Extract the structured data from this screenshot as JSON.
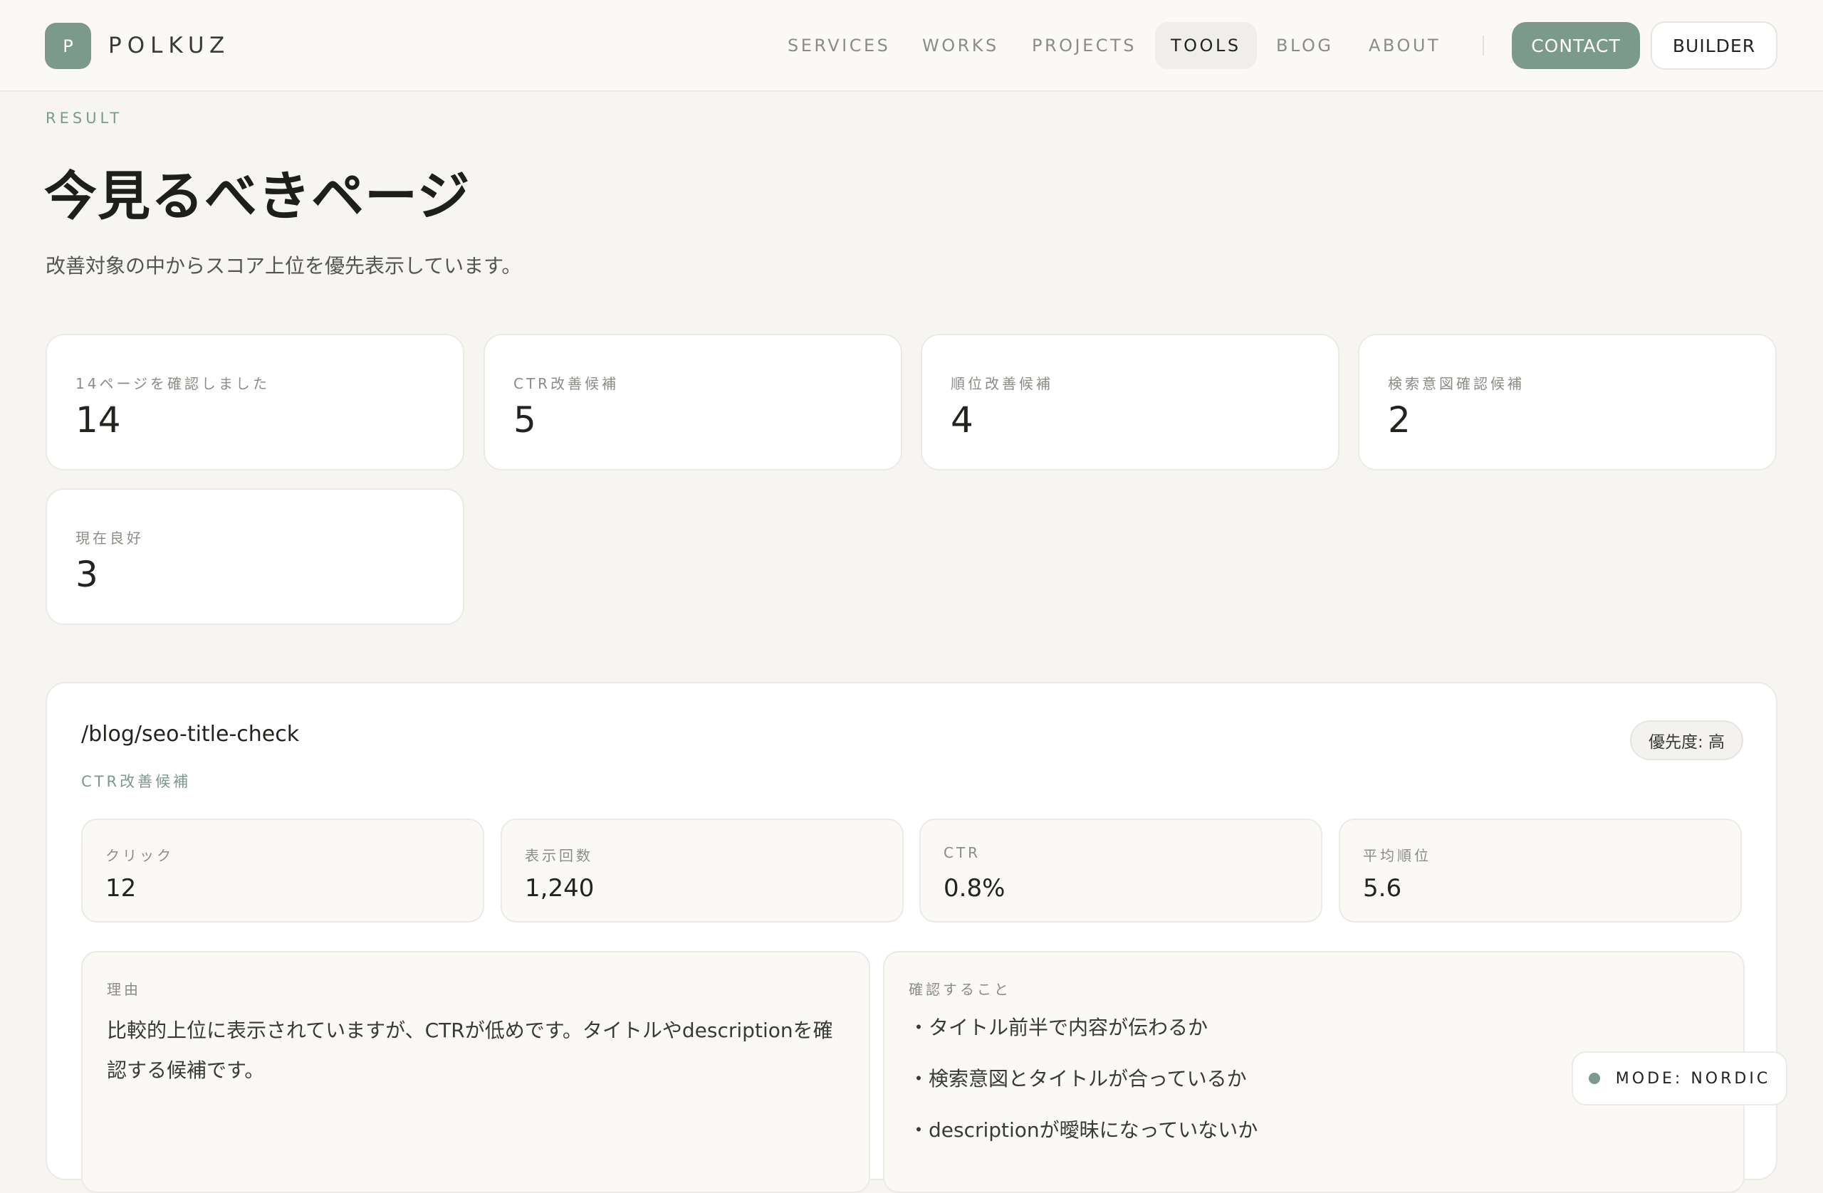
{
  "header": {
    "logo_letter": "P",
    "brand": "POLKUZ",
    "nav": [
      "SERVICES",
      "WORKS",
      "PROJECTS",
      "TOOLS",
      "BLOG",
      "ABOUT"
    ],
    "active_nav": "TOOLS",
    "contact_label": "CONTACT",
    "builder_label": "BUILDER"
  },
  "hero": {
    "eyebrow": "RESULT",
    "title": "今見るべきページ",
    "subtitle": "改善対象の中からスコア上位を優先表示しています。"
  },
  "stats": [
    {
      "label": "14ページを確認しました",
      "value": "14"
    },
    {
      "label": "CTR改善候補",
      "value": "5"
    },
    {
      "label": "順位改善候補",
      "value": "4"
    },
    {
      "label": "検索意図確認候補",
      "value": "2"
    },
    {
      "label": "現在良好",
      "value": "3"
    }
  ],
  "detail": {
    "path": "/blog/seo-title-check",
    "category": "CTR改善候補",
    "priority": "優先度: 高",
    "metrics": [
      {
        "label": "クリック",
        "value": "12"
      },
      {
        "label": "表示回数",
        "value": "1,240"
      },
      {
        "label": "CTR",
        "value": "0.8%"
      },
      {
        "label": "平均順位",
        "value": "5.6"
      }
    ],
    "reason_label": "理由",
    "reason_text": "比較的上位に表示されていますが、CTRが低めです。タイトルやdescriptionを確認する候補です。",
    "check_label": "確認すること",
    "checks": [
      "・タイトル前半で内容が伝わるか",
      "・検索意図とタイトルが合っているか",
      "・descriptionが曖昧になっていないか"
    ]
  },
  "mode": {
    "label": "MODE: NORDIC"
  },
  "colors": {
    "accent": "#7b9a8c",
    "background": "#f6f5f2",
    "card": "#ffffff"
  }
}
